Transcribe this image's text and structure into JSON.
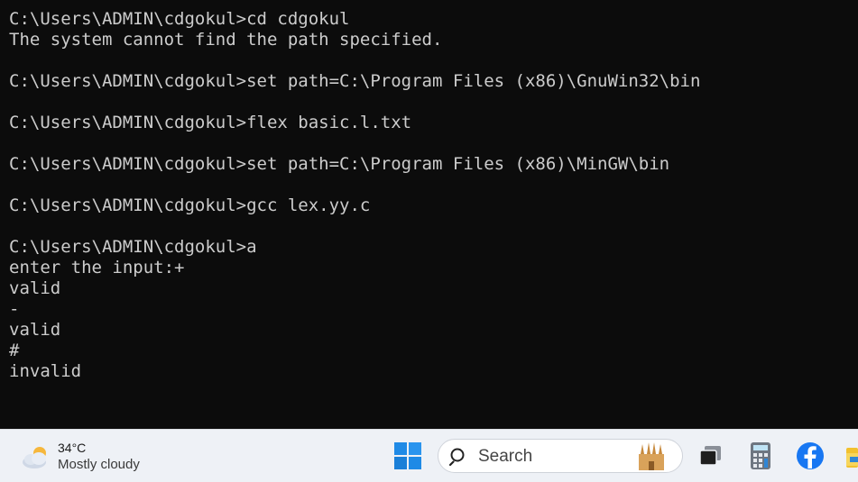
{
  "terminal": {
    "lines": [
      "C:\\Users\\ADMIN\\cdgokul>cd cdgokul",
      "The system cannot find the path specified.",
      "",
      "C:\\Users\\ADMIN\\cdgokul>set path=C:\\Program Files (x86)\\GnuWin32\\bin",
      "",
      "C:\\Users\\ADMIN\\cdgokul>flex basic.l.txt",
      "",
      "C:\\Users\\ADMIN\\cdgokul>set path=C:\\Program Files (x86)\\MinGW\\bin",
      "",
      "C:\\Users\\ADMIN\\cdgokul>gcc lex.yy.c",
      "",
      "C:\\Users\\ADMIN\\cdgokul>a",
      "enter the input:+",
      "valid",
      "-",
      "valid",
      "#",
      "invalid"
    ]
  },
  "taskbar": {
    "weather": {
      "temp": "34°C",
      "condition": "Mostly cloudy",
      "icon": "partly-cloudy-icon"
    },
    "search": {
      "label": "Search",
      "icon": "search-icon",
      "highlight_icon": "landmark-highlight-icon"
    },
    "apps": [
      {
        "name": "task-view-icon"
      },
      {
        "name": "calculator-icon"
      },
      {
        "name": "facebook-icon"
      },
      {
        "name": "file-explorer-icon"
      }
    ],
    "colors": {
      "start": "#1f8ae6",
      "facebook": "#1877f2",
      "folder": "#f2c12e"
    }
  }
}
